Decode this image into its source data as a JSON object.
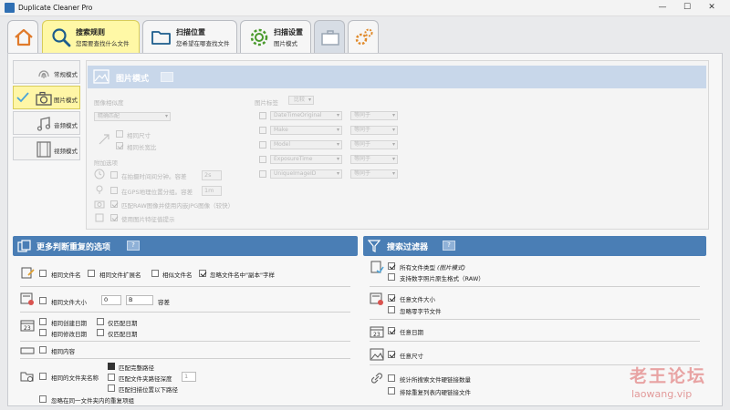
{
  "window": {
    "title": "Duplicate Cleaner Pro",
    "controls": [
      "—",
      "☐",
      "✕"
    ]
  },
  "tabs": [
    {
      "title": "",
      "subtitle": ""
    },
    {
      "title": "搜索规则",
      "subtitle": "您需要查找什么文件"
    },
    {
      "title": "扫描位置",
      "subtitle": "您希望在哪查找文件"
    },
    {
      "title": "扫描设置",
      "subtitle": "图片模式"
    }
  ],
  "modes": [
    "常规模式",
    "图片模式",
    "音频模式",
    "视频模式"
  ],
  "photo": {
    "title": "图片模式",
    "match_label": "图像相似度",
    "match_value": "精确匹配",
    "tags_label": "图片标签",
    "tags_button": "比较",
    "same_size": "相同尺寸",
    "same_ratio": "相同长宽比",
    "other_options": "附加选项",
    "within_seconds": "在拍摄时间间分钟。容差",
    "seconds_value": "2s",
    "gps": "在GPS地理位置分组。容差",
    "gps_value": "1m",
    "raw": "匹配RAW图像并使用内嵌JPG图像（较快）",
    "rotate": "使用图片特征值提示",
    "tag_rows": [
      {
        "tag": "DateTimeOriginal",
        "op": "等同于"
      },
      {
        "tag": "Make",
        "op": "等同于"
      },
      {
        "tag": "Model",
        "op": "等同于"
      },
      {
        "tag": "ExposureTime",
        "op": "等同于"
      },
      {
        "tag": "UniqueImageID",
        "op": "等同于"
      }
    ]
  },
  "left_section": {
    "title": "更多判断重复的选项",
    "help": "?",
    "same_name": "相同文件名",
    "same_ext": "相同文件扩展名",
    "similar_name": "相似文件名",
    "ignore_copy": "忽略文件名中\"副本\"字样",
    "same_size": "相同文件大小",
    "size_value": "0",
    "size_unit": "B",
    "tolerance": "容差",
    "same_created": "相同创建日期",
    "only_date_1": "仅匹配日期",
    "same_modified": "相同修改日期",
    "only_date_2": "仅匹配日期",
    "same_content": "相同内容",
    "same_folder": "相同的文件夹名称",
    "match_full_path": "匹配完整路径",
    "match_path_depth": "匹配文件夹路径深度",
    "path_depth_value": "1",
    "match_below": "匹配扫描位置以下路径",
    "ignore_same_folder": "忽略在同一文件夹内的重复项组"
  },
  "right_section": {
    "title": "搜索过滤器",
    "help": "?",
    "all_types": "所有文件类型",
    "all_types_note": "(图片模式)",
    "raw_support": "支持数字照片原生格式（RAW）",
    "any_size": "任意文件大小",
    "ignore_zero": "忽略零字节文件",
    "any_date": "任意日期",
    "any_dimensions": "任意尺寸",
    "count_hardlinks": "统计所搜索文件硬链接数量",
    "exclude_hardlinks": "排除重复列表内硬链接文件"
  },
  "watermark": {
    "line1": "老王论坛",
    "line2": "laowang.vip"
  },
  "colors": {
    "accent": "#4a7eb5",
    "active_tab": "#fff8a6",
    "photo_header": "#c8d7ea"
  }
}
